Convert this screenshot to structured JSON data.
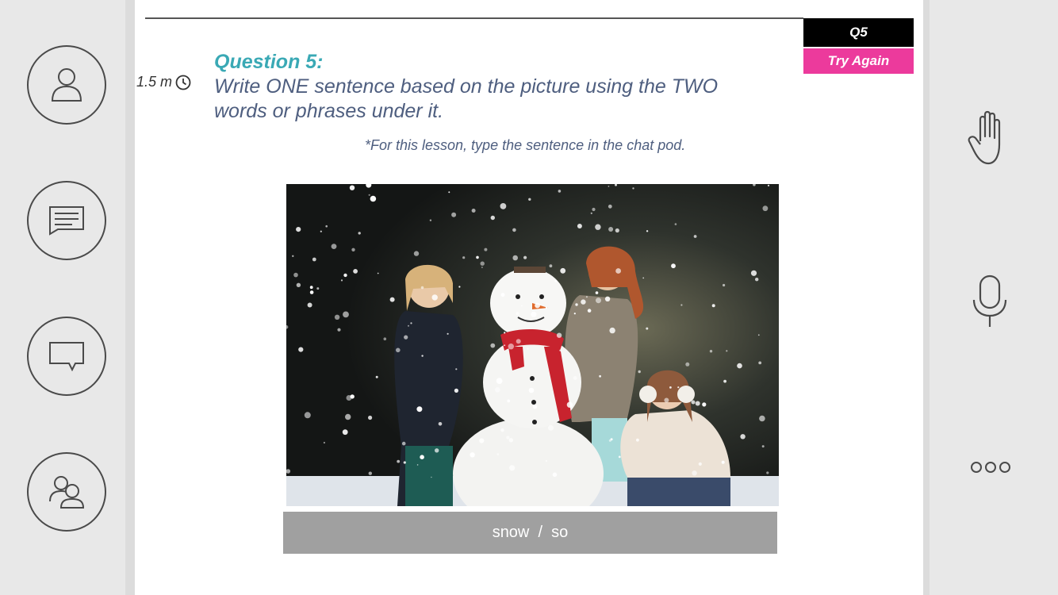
{
  "question": {
    "badge": "Q5",
    "try_again": "Try Again",
    "timer": "1.5 m",
    "title": "Question 5:",
    "text": "Write ONE sentence based on the picture using the TWO words or phrases under it.",
    "note": "*For this lesson, type the sentence in the chat pod.",
    "words": "snow  /  so"
  },
  "icons": {
    "left": [
      "user-icon",
      "notes-icon",
      "chat-icon",
      "attendees-icon"
    ],
    "right": [
      "raise-hand-icon",
      "microphone-icon",
      "more-icon"
    ]
  },
  "colors": {
    "title": "#3aa9b5",
    "text": "#4e5e7f",
    "try_again_bg": "#ec3a9c",
    "word_bar_bg": "#a0a0a0"
  }
}
